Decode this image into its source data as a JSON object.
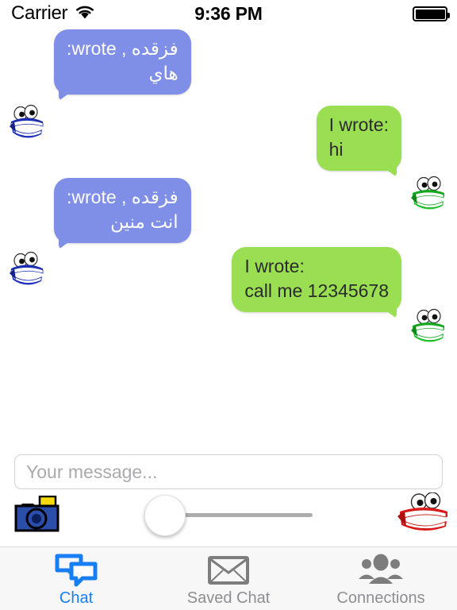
{
  "status_bar": {
    "carrier": "Carrier",
    "wifi_icon": "wifi-icon",
    "time": "9:36 PM",
    "battery_icon": "battery-full-icon"
  },
  "chat": {
    "messages": [
      {
        "id": "msg-1",
        "direction": "incoming",
        "sender_prefix": "فزقده , wrote:",
        "body": "هاي",
        "avatar_icon": "blue-chattering-teeth-avatar",
        "bubble_color": "#7f8fe8",
        "text_color": "#ffffff"
      },
      {
        "id": "msg-2",
        "direction": "outgoing",
        "sender_prefix": "I wrote:",
        "body": "hi",
        "avatar_icon": "green-chattering-teeth-avatar",
        "bubble_color": "#9ade52",
        "text_color": "#2b2b2b"
      },
      {
        "id": "msg-3",
        "direction": "incoming",
        "sender_prefix": "فزقده , wrote:",
        "body": "انت منين",
        "avatar_icon": "blue-chattering-teeth-avatar",
        "bubble_color": "#7f8fe8",
        "text_color": "#ffffff"
      },
      {
        "id": "msg-4",
        "direction": "outgoing",
        "sender_prefix": "I wrote:",
        "body": "call me 12345678",
        "avatar_icon": "green-chattering-teeth-avatar",
        "bubble_color": "#9ade52",
        "text_color": "#2b2b2b"
      }
    ]
  },
  "composer": {
    "input_placeholder": "Your message...",
    "input_value": "",
    "camera_icon": "camera-icon",
    "teeth_icon": "red-chattering-teeth-icon",
    "slider": {
      "name": "volume-slider",
      "value": 0,
      "min": 0,
      "max": 100
    }
  },
  "tab_bar": {
    "active_color": "#177ef4",
    "inactive_color": "#8e8e93",
    "tabs": [
      {
        "id": "chat",
        "label": "Chat",
        "icon": "speech-bubbles-icon",
        "active": true
      },
      {
        "id": "saved-chat",
        "label": "Saved Chat",
        "icon": "envelope-icon",
        "active": false
      },
      {
        "id": "connections",
        "label": "Connections",
        "icon": "people-group-icon",
        "active": false
      }
    ]
  }
}
